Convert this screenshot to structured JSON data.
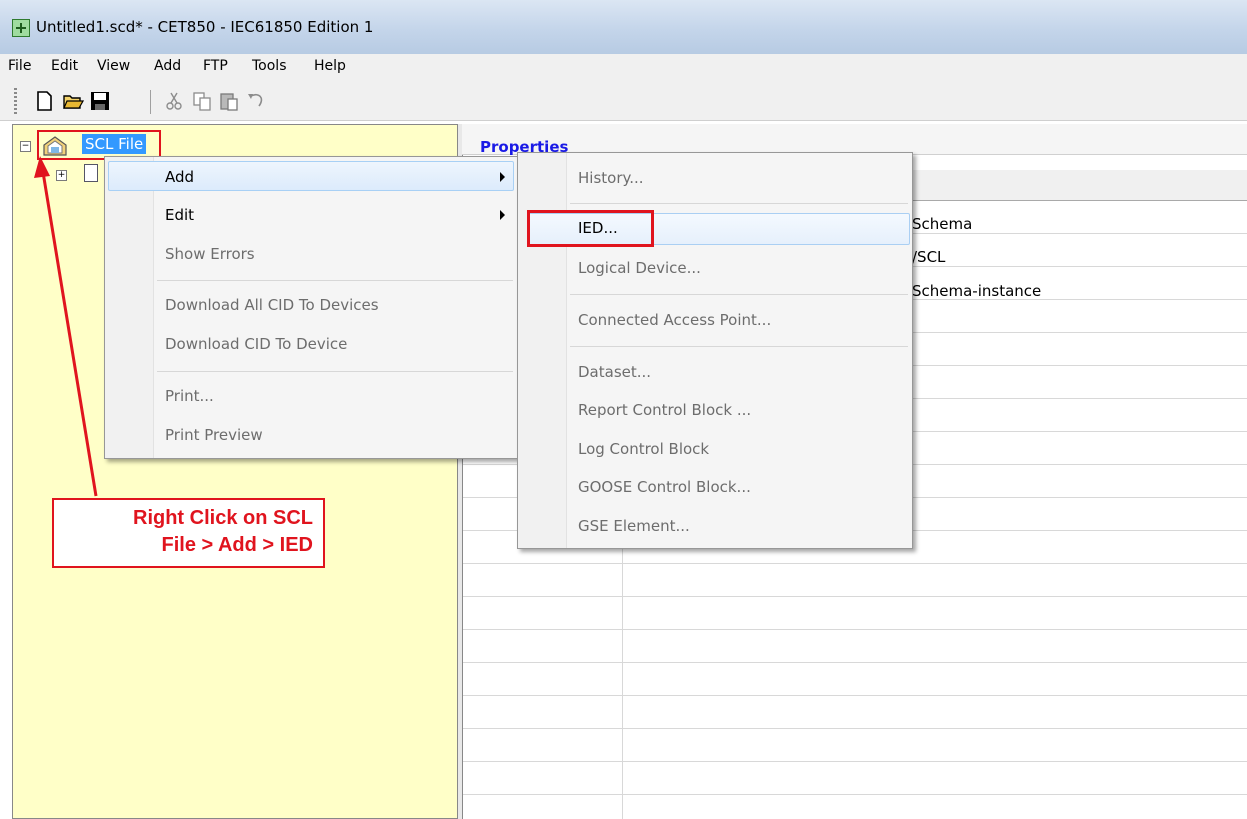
{
  "window": {
    "title": "Untitled1.scd* - CET850 - IEC61850 Edition 1"
  },
  "menubar": {
    "items": [
      "File",
      "Edit",
      "View",
      "Add",
      "FTP",
      "Tools",
      "Help"
    ]
  },
  "toolbar": {
    "icons": [
      "new-file-icon",
      "open-folder-icon",
      "save-icon",
      "cut-icon",
      "copy-icon",
      "paste-icon",
      "undo-icon"
    ]
  },
  "tree": {
    "root_label": "SCL File",
    "root_expander": "−",
    "child_expander": "+"
  },
  "properties": {
    "title": "Properties",
    "values": [
      "Schema",
      "/SCL",
      "Schema-instance"
    ]
  },
  "context_menu": {
    "add": "Add",
    "edit": "Edit",
    "show_errors": "Show Errors",
    "download_all": "Download All CID To Devices",
    "download_one": "Download CID To Device",
    "print": "Print...",
    "print_preview": "Print Preview"
  },
  "submenu": {
    "history": "History...",
    "ied": "IED...",
    "logical_device": "Logical Device...",
    "connected_ap": "Connected Access Point...",
    "dataset": "Dataset...",
    "report_cb": "Report Control Block ...",
    "log_cb": "Log Control Block",
    "goose_cb": "GOOSE Control Block...",
    "gse_element": "GSE Element..."
  },
  "annotation": {
    "line1": "Right Click on SCL",
    "line2": "File > Add > IED"
  },
  "colors": {
    "highlight_red": "#e0141e",
    "tree_bg": "#ffffc8",
    "selection_blue": "#3399ff"
  }
}
